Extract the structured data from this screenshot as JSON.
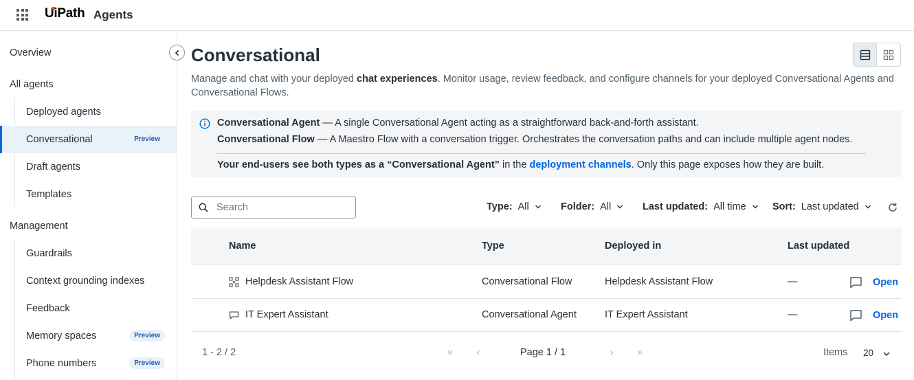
{
  "header": {
    "logo_text": "UiPath",
    "product": "Agents"
  },
  "sidebar": {
    "overview": "Overview",
    "all_agents": "All agents",
    "agent_items": [
      {
        "label": "Deployed agents",
        "badge": ""
      },
      {
        "label": "Conversational",
        "badge": "Preview"
      },
      {
        "label": "Draft agents",
        "badge": ""
      },
      {
        "label": "Templates",
        "badge": ""
      }
    ],
    "management": "Management",
    "management_items": [
      {
        "label": "Guardrails",
        "badge": ""
      },
      {
        "label": "Context grounding indexes",
        "badge": ""
      },
      {
        "label": "Feedback",
        "badge": ""
      },
      {
        "label": "Memory spaces",
        "badge": "Preview"
      },
      {
        "label": "Phone numbers",
        "badge": "Preview"
      }
    ]
  },
  "main": {
    "title": "Conversational",
    "desc_pre": "Manage and chat with your deployed ",
    "desc_bold": "chat experiences",
    "desc_post": ". Monitor usage, review feedback, and configure channels for your deployed Conversational Agents and Conversational Flows.",
    "info": {
      "line1_bold": "Conversational Agent",
      "line1_rest": " — A single Conversational Agent acting as a straightforward back-and-forth assistant.",
      "line2_bold": "Conversational Flow",
      "line2_rest": " — A Maestro Flow with a conversation trigger. Orchestrates the conversation paths and can include multiple agent nodes.",
      "line3_bold": "Your end-users see both types as a “Conversational Agent”",
      "line3_mid": " in the ",
      "line3_link": "deployment channels",
      "line3_end": ". Only this page exposes how they are built."
    },
    "search_placeholder": "Search",
    "filters": {
      "type_label": "Type:",
      "type_value": "All",
      "folder_label": "Folder:",
      "folder_value": "All",
      "updated_label": "Last updated:",
      "updated_value": "All time",
      "sort_label": "Sort:",
      "sort_value": "Last updated"
    },
    "table": {
      "headers": {
        "name": "Name",
        "type": "Type",
        "deployed": "Deployed in",
        "updated": "Last updated"
      },
      "rows": [
        {
          "name": "Helpdesk Assistant Flow",
          "type": "Conversational Flow",
          "deployed": "Helpdesk Assistant Flow",
          "updated": "—",
          "action": "Open",
          "icon": "flow-icon"
        },
        {
          "name": "IT Expert Assistant",
          "type": "Conversational Agent",
          "deployed": "IT Expert Assistant",
          "updated": "—",
          "action": "Open",
          "icon": "agent-icon"
        }
      ]
    },
    "pager": {
      "range": "1 - 2 / 2",
      "page": "Page 1 / 1",
      "items_label": "Items",
      "items_value": "20"
    }
  },
  "colors": {
    "accent": "#0067df",
    "active_bg": "#e9f1fa",
    "brand": "#fa4616"
  }
}
